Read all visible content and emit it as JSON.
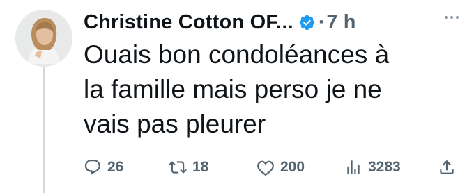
{
  "tweet": {
    "author": "Christine Cotton OF...",
    "separator": "·",
    "time": "7 h",
    "text_lines": [
      "Ouais bon condoléances à",
      "la famille mais perso je ne",
      "vais pas pleurer"
    ],
    "actions": {
      "replies": "26",
      "retweets": "18",
      "likes": "200",
      "views": "3283"
    }
  },
  "icons": {
    "verified": "verified-badge-icon",
    "more": "more-icon",
    "reply": "reply-icon",
    "retweet": "retweet-icon",
    "like": "heart-icon",
    "views": "views-icon",
    "share": "share-icon"
  },
  "colors": {
    "text": "#0f1419",
    "secondary": "#536471",
    "verified": "#1d9bf0",
    "thread_line": "#cfd9de"
  }
}
